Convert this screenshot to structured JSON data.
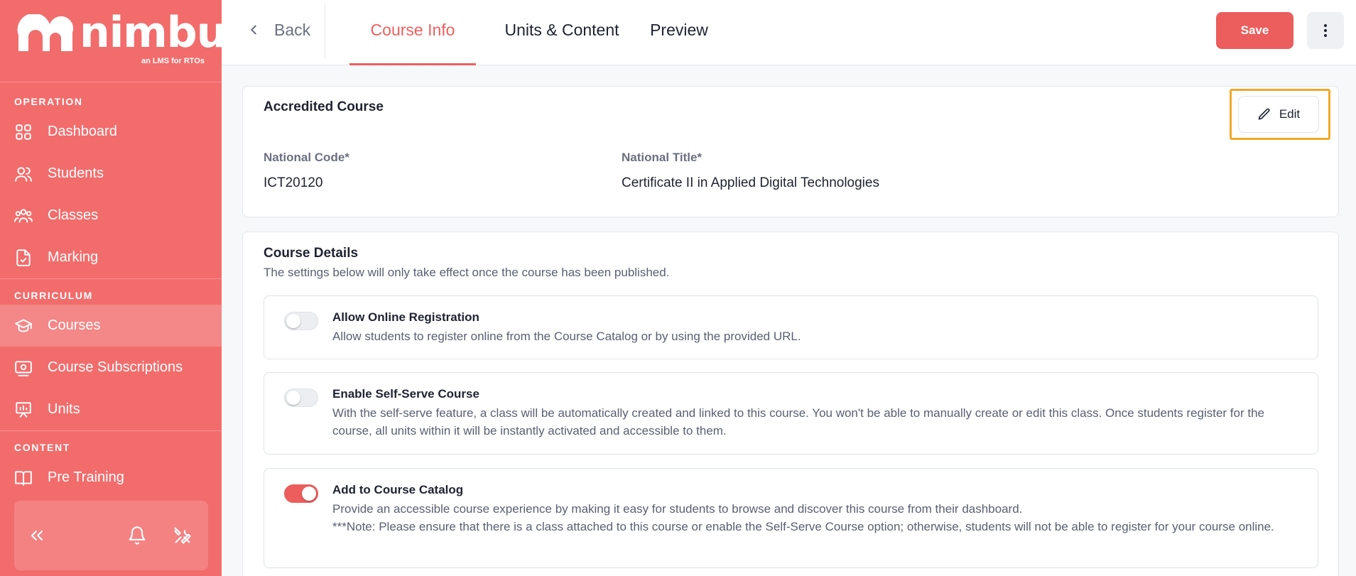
{
  "brand": {
    "name": "nimbu",
    "tagline": "an LMS for RTOs"
  },
  "sidebar": {
    "sections": [
      {
        "label": "OPERATION",
        "items": [
          {
            "label": "Dashboard",
            "icon": "dashboard-icon"
          },
          {
            "label": "Students",
            "icon": "students-icon"
          },
          {
            "label": "Classes",
            "icon": "classes-icon"
          },
          {
            "label": "Marking",
            "icon": "marking-icon"
          }
        ]
      },
      {
        "label": "CURRICULUM",
        "items": [
          {
            "label": "Courses",
            "icon": "graduation-cap-icon",
            "active": true
          },
          {
            "label": "Course Subscriptions",
            "icon": "subscription-icon"
          },
          {
            "label": "Units",
            "icon": "units-icon"
          }
        ]
      },
      {
        "label": "CONTENT",
        "items": [
          {
            "label": "Pre Training",
            "icon": "book-icon"
          }
        ]
      }
    ],
    "footer": {
      "collapse_icon": "double-chevron-left-icon",
      "notifications_icon": "bell-icon",
      "tools_icon": "tools-icon"
    }
  },
  "topbar": {
    "back_label": "Back",
    "tabs": [
      {
        "label": "Course Info",
        "active": true
      },
      {
        "label": "Units & Content",
        "active": false
      },
      {
        "label": "Preview",
        "active": false
      }
    ],
    "save_label": "Save",
    "more_icon": "more-vertical-icon"
  },
  "accredited": {
    "title": "Accredited Course",
    "edit_label": "Edit",
    "national_code_label": "National Code*",
    "national_code_value": "ICT20120",
    "national_title_label": "National Title*",
    "national_title_value": "Certificate II in Applied Digital Technologies"
  },
  "details": {
    "title": "Course Details",
    "subtitle": "The settings below will only take effect once the course has been published.",
    "settings": [
      {
        "title": "Allow Online Registration",
        "enabled": false,
        "description": "Allow students to register online from the Course Catalog or by using the provided URL."
      },
      {
        "title": "Enable Self-Serve Course",
        "enabled": false,
        "description": "With the self-serve feature, a class will be automatically created and linked to this course. You won't be able to manually create or edit this class. Once students register for the course, all units within it will be instantly activated and accessible to them."
      },
      {
        "title": "Add to Course Catalog",
        "enabled": true,
        "description": "Provide an accessible course experience by making it easy for students to browse and discover this course from their dashboard.",
        "note": "***Note: Please ensure that there is a class attached to this course or enable the Self-Serve Course option; otherwise, students will not be able to register for your course online."
      }
    ]
  },
  "colors": {
    "accent": "#ec5d5d",
    "sidebar": "#f26c6c",
    "highlight": "#f0a82a"
  }
}
